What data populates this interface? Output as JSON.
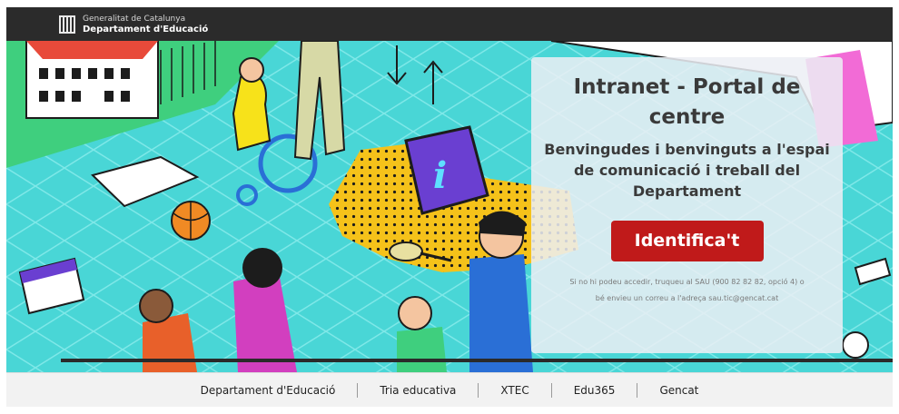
{
  "header": {
    "org_line1": "Generalitat de Catalunya",
    "org_line2": "Departament d'Educació"
  },
  "panel": {
    "title": "Intranet - Portal de centre",
    "subtitle": "Benvingudes i benvinguts a l'espai de comunicació i treball del Departament",
    "login_button": "Identifica't",
    "help_text": "Si no hi podeu accedir, truqueu al SAU (900 82 82 82, opció 4) o bé envieu un correu a l'adreça sau.tic@gencat.cat"
  },
  "footer": {
    "links": [
      "Departament d'Educació",
      "Tria educativa",
      "XTEC",
      "Edu365",
      "Gencat"
    ]
  },
  "illustration": {
    "info_icon_glyph": "i"
  },
  "colors": {
    "topbar": "#2b2b2b",
    "hero_background": "#49d6d6",
    "login_button": "#c01a1a",
    "footer": "#f2f2f2"
  }
}
